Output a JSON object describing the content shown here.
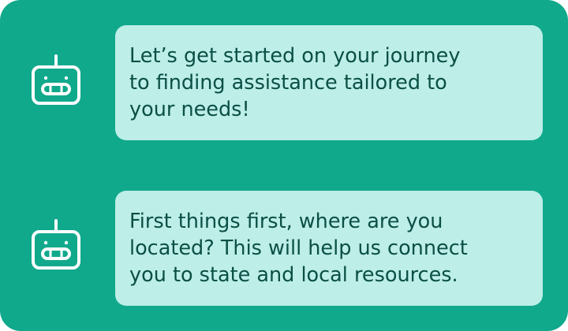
{
  "colors": {
    "panel_background": "#10a98c",
    "bubble_background": "#bdeee8",
    "message_text": "#0b4f45",
    "icon_stroke": "#ffffff"
  },
  "messages": [
    {
      "sender_icon": "robot-icon",
      "lines": [
        "Let’s get started on your journey",
        "to finding assistance tailored to",
        "your needs!"
      ]
    },
    {
      "sender_icon": "robot-icon",
      "lines": [
        "First things first, where are you",
        "located? This will help us connect",
        "you to state and local resources."
      ]
    }
  ]
}
